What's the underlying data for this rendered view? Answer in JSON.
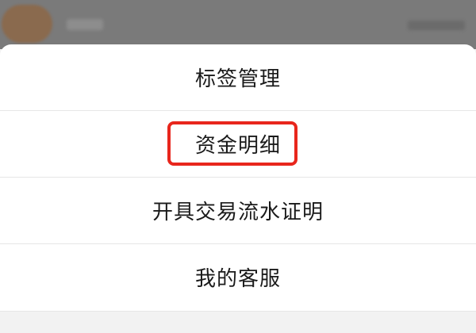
{
  "action_sheet": {
    "items": [
      {
        "label": "标签管理"
      },
      {
        "label": "资金明细"
      },
      {
        "label": "开具交易流水证明"
      },
      {
        "label": "我的客服"
      }
    ]
  },
  "annotation": {
    "color": "#e8261c",
    "highlighted_item": "资金明细"
  },
  "colors": {
    "sheet_background": "#ffffff",
    "overlay": "#7a7a7a",
    "text": "#1a1a1a",
    "divider": "#e6e6e6"
  }
}
